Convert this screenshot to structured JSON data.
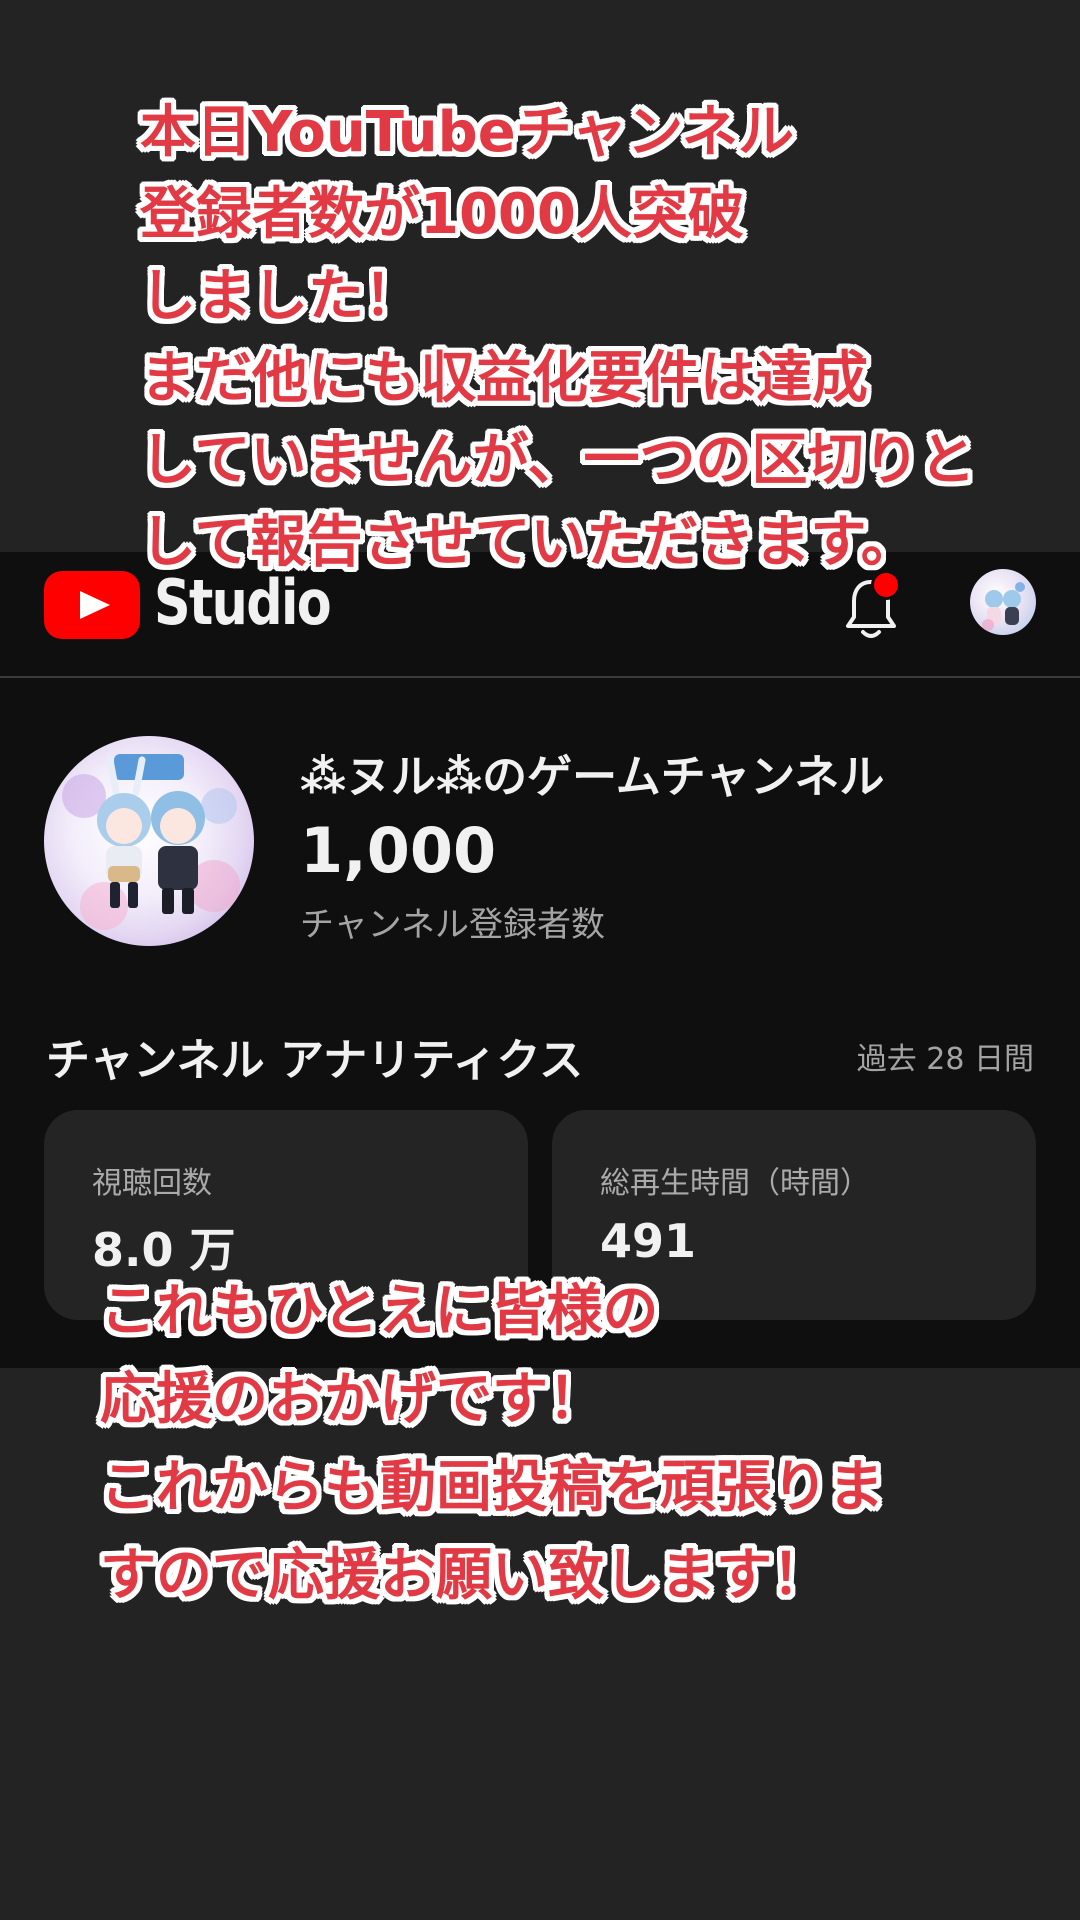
{
  "overlay": {
    "top_lines": [
      "本日YouTubeチャンネル",
      "登録者数が1000人突破",
      "しました！",
      "まだ他にも収益化要件は達成",
      "していませんが、一つの区切りと",
      "して報告させていただきます。"
    ],
    "bottom_lines": [
      "これもひとえに皆様の",
      "応援のおかげです！",
      "これからも動画投稿を頑張りま",
      "すので応援お願い致します！"
    ]
  },
  "header": {
    "logo_text": "Studio",
    "logo_icon": "youtube-play-icon",
    "notification_icon": "bell-icon",
    "has_notification": true
  },
  "channel": {
    "name": "⁂ヌル⁂のゲームチャンネル",
    "subscribers": "1,000",
    "subscribers_label": "チャンネル登録者数"
  },
  "analytics": {
    "title": "チャンネル アナリティクス",
    "period": "過去 28 日間",
    "cards": [
      {
        "label": "視聴回数",
        "value": "8.0 万"
      },
      {
        "label": "総再生時間（時間）",
        "value": "491"
      }
    ]
  },
  "colors": {
    "caption_text": "#e23a44",
    "caption_outline": "#ffffff",
    "youtube_red": "#ff0000",
    "app_background": "#0f0f0f",
    "card_background": "#242424"
  }
}
